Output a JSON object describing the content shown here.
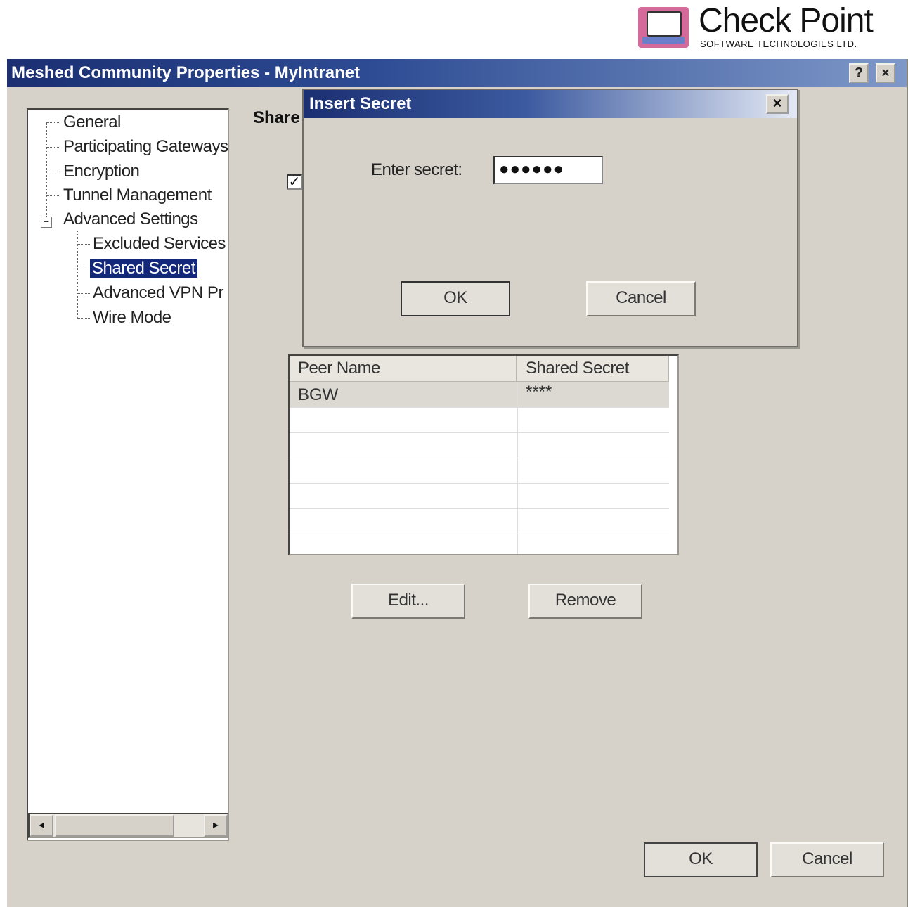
{
  "logo": {
    "title": "Check Point",
    "subtitle": "SOFTWARE TECHNOLOGIES LTD."
  },
  "window": {
    "title": "Meshed Community Properties - MyIntranet",
    "help_label": "?",
    "close_label": "×"
  },
  "tree": {
    "items": [
      {
        "label": "General"
      },
      {
        "label": "Participating Gateways"
      },
      {
        "label": "Encryption"
      },
      {
        "label": "Tunnel Management"
      },
      {
        "label": "Advanced Settings"
      },
      {
        "label": "Excluded Services"
      },
      {
        "label": "Shared Secret"
      },
      {
        "label": "Advanced VPN Pr"
      },
      {
        "label": "Wire Mode"
      }
    ],
    "expander": "−",
    "scroll_left": "◂",
    "scroll_right": "▸"
  },
  "panel": {
    "heading": "Share",
    "checkbox_mark": "✓"
  },
  "table": {
    "columns": [
      "Peer Name",
      "Shared Secret"
    ],
    "rows": [
      {
        "peer": "BGW",
        "secret": "****"
      }
    ]
  },
  "buttons": {
    "edit": "Edit...",
    "remove": "Remove",
    "ok": "OK",
    "cancel": "Cancel"
  },
  "dialog": {
    "title": "Insert Secret",
    "close_label": "×",
    "label": "Enter secret:",
    "value": "●●●●●●",
    "ok": "OK",
    "cancel": "Cancel"
  },
  "colors": {
    "titlebar": "#1b2f72",
    "window_bg": "#d6d2ca",
    "selection": "#13287a",
    "logo_accent": "#d46a9a"
  }
}
